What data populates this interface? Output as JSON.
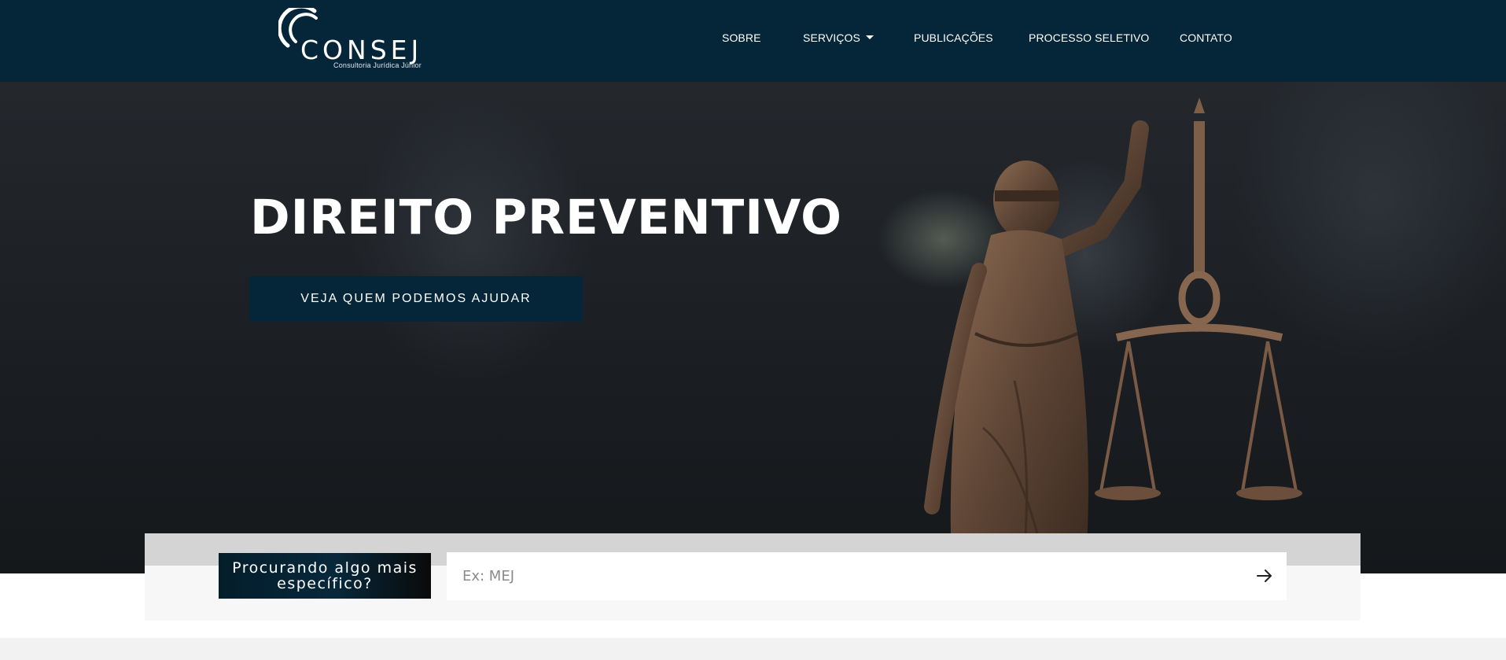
{
  "header": {
    "logo": {
      "wordmark": "CONSEJ",
      "tagline": "Consultoria Jurídica Júnior",
      "icon": "consej-arc-logo-icon"
    },
    "nav": [
      {
        "label": "SOBRE"
      },
      {
        "label": "SERVIÇOS",
        "has_dropdown": true
      },
      {
        "label": "PUBLICAÇÕES"
      },
      {
        "label": "PROCESSO SELETIVO"
      },
      {
        "label": "CONTATO"
      }
    ]
  },
  "hero": {
    "title": "DIREITO PREVENTIVO",
    "cta_label": "VEJA QUEM PODEMOS AJUDAR",
    "image": "lady-justice-statue-icon"
  },
  "search": {
    "label": "Procurando algo mais específico?",
    "placeholder": "Ex: MEJ",
    "value": "",
    "submit_icon": "arrow-right-icon"
  },
  "colors": {
    "brand_navy": "#052538",
    "hero_dark": "#1b1e22",
    "search_band": "#d4d4d4"
  }
}
